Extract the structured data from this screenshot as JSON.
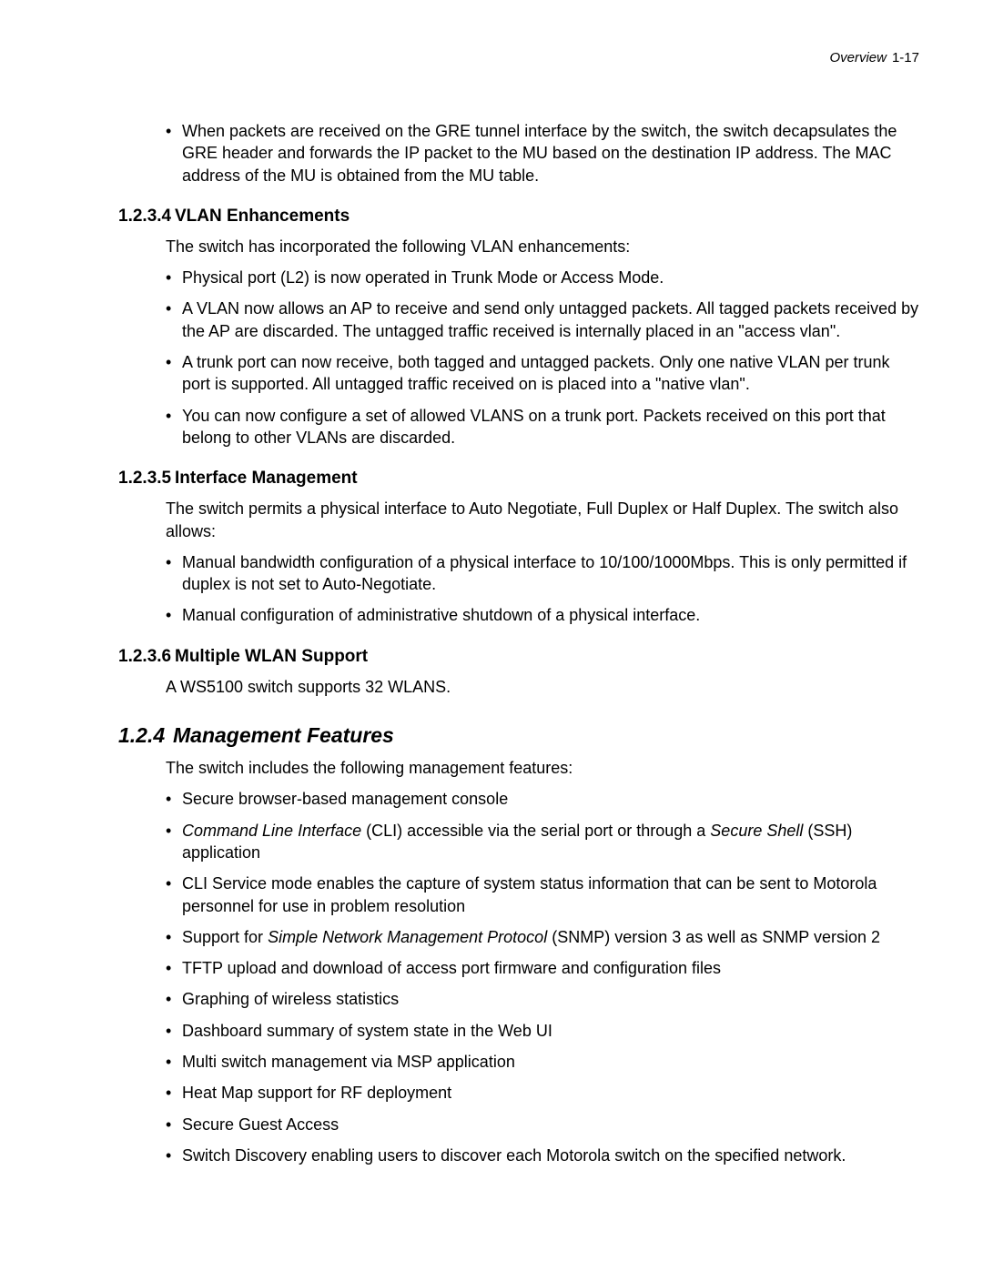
{
  "header": {
    "section": "Overview",
    "page": "1-17"
  },
  "topBullets": [
    "When packets are received on the GRE tunnel interface by the switch, the switch decapsulates the GRE header and forwards the IP packet to the MU based on the destination IP address. The MAC address of the MU is obtained from the MU table."
  ],
  "s1": {
    "num": "1.2.3.4",
    "title": "VLAN Enhancements",
    "intro": "The switch has incorporated the following VLAN enhancements:",
    "bullets": [
      "Physical port (L2) is now operated in Trunk Mode or Access Mode.",
      "A VLAN now allows an AP to receive and send only untagged packets. All tagged packets received by the AP are discarded. The untagged traffic received is internally placed in an \"access vlan\".",
      "A trunk port can now receive, both tagged and untagged packets. Only one native VLAN per trunk port is supported. All untagged traffic received on is placed into a \"native vlan\".",
      "You can now configure a set of allowed VLANS on a trunk port. Packets received on this port that belong to other VLANs are discarded."
    ]
  },
  "s2": {
    "num": "1.2.3.5",
    "title": "Interface Management",
    "intro": "The switch permits a physical interface to Auto Negotiate, Full Duplex or Half Duplex. The switch also allows:",
    "bullets": [
      "Manual bandwidth configuration of a physical interface to 10/100/1000Mbps. This is only permitted if duplex is not set to Auto-Negotiate.",
      "Manual configuration of administrative shutdown of a physical interface."
    ]
  },
  "s3": {
    "num": "1.2.3.6",
    "title": "Multiple WLAN Support",
    "intro": "A WS5100 switch supports 32 WLANS."
  },
  "s4": {
    "num": "1.2.4",
    "title": "Management Features",
    "intro": "The switch includes the following management features:",
    "bullets_plain": {
      "b0": "Secure browser-based management console",
      "b2": "CLI Service mode enables the capture of system status information that can be sent to Motorola personnel for use in problem resolution",
      "b4": "TFTP upload and download of access port firmware and configuration files",
      "b5": "Graphing of wireless statistics",
      "b6": "Dashboard summary of system state in the Web UI",
      "b7": "Multi switch management via MSP application",
      "b8": "Heat Map support for RF deployment",
      "b9": "Secure Guest Access",
      "b10": "Switch Discovery enabling users to discover each Motorola switch on the specified network."
    },
    "b1": {
      "i1": "Command Line Interface",
      "t1": " (CLI) accessible via the serial port or through a ",
      "i2": "Secure Shell",
      "t2": " (SSH) application"
    },
    "b3": {
      "t1": "Support for ",
      "i1": "Simple Network Management Protocol",
      "t2": " (SNMP) version 3 as well as SNMP version 2"
    }
  }
}
